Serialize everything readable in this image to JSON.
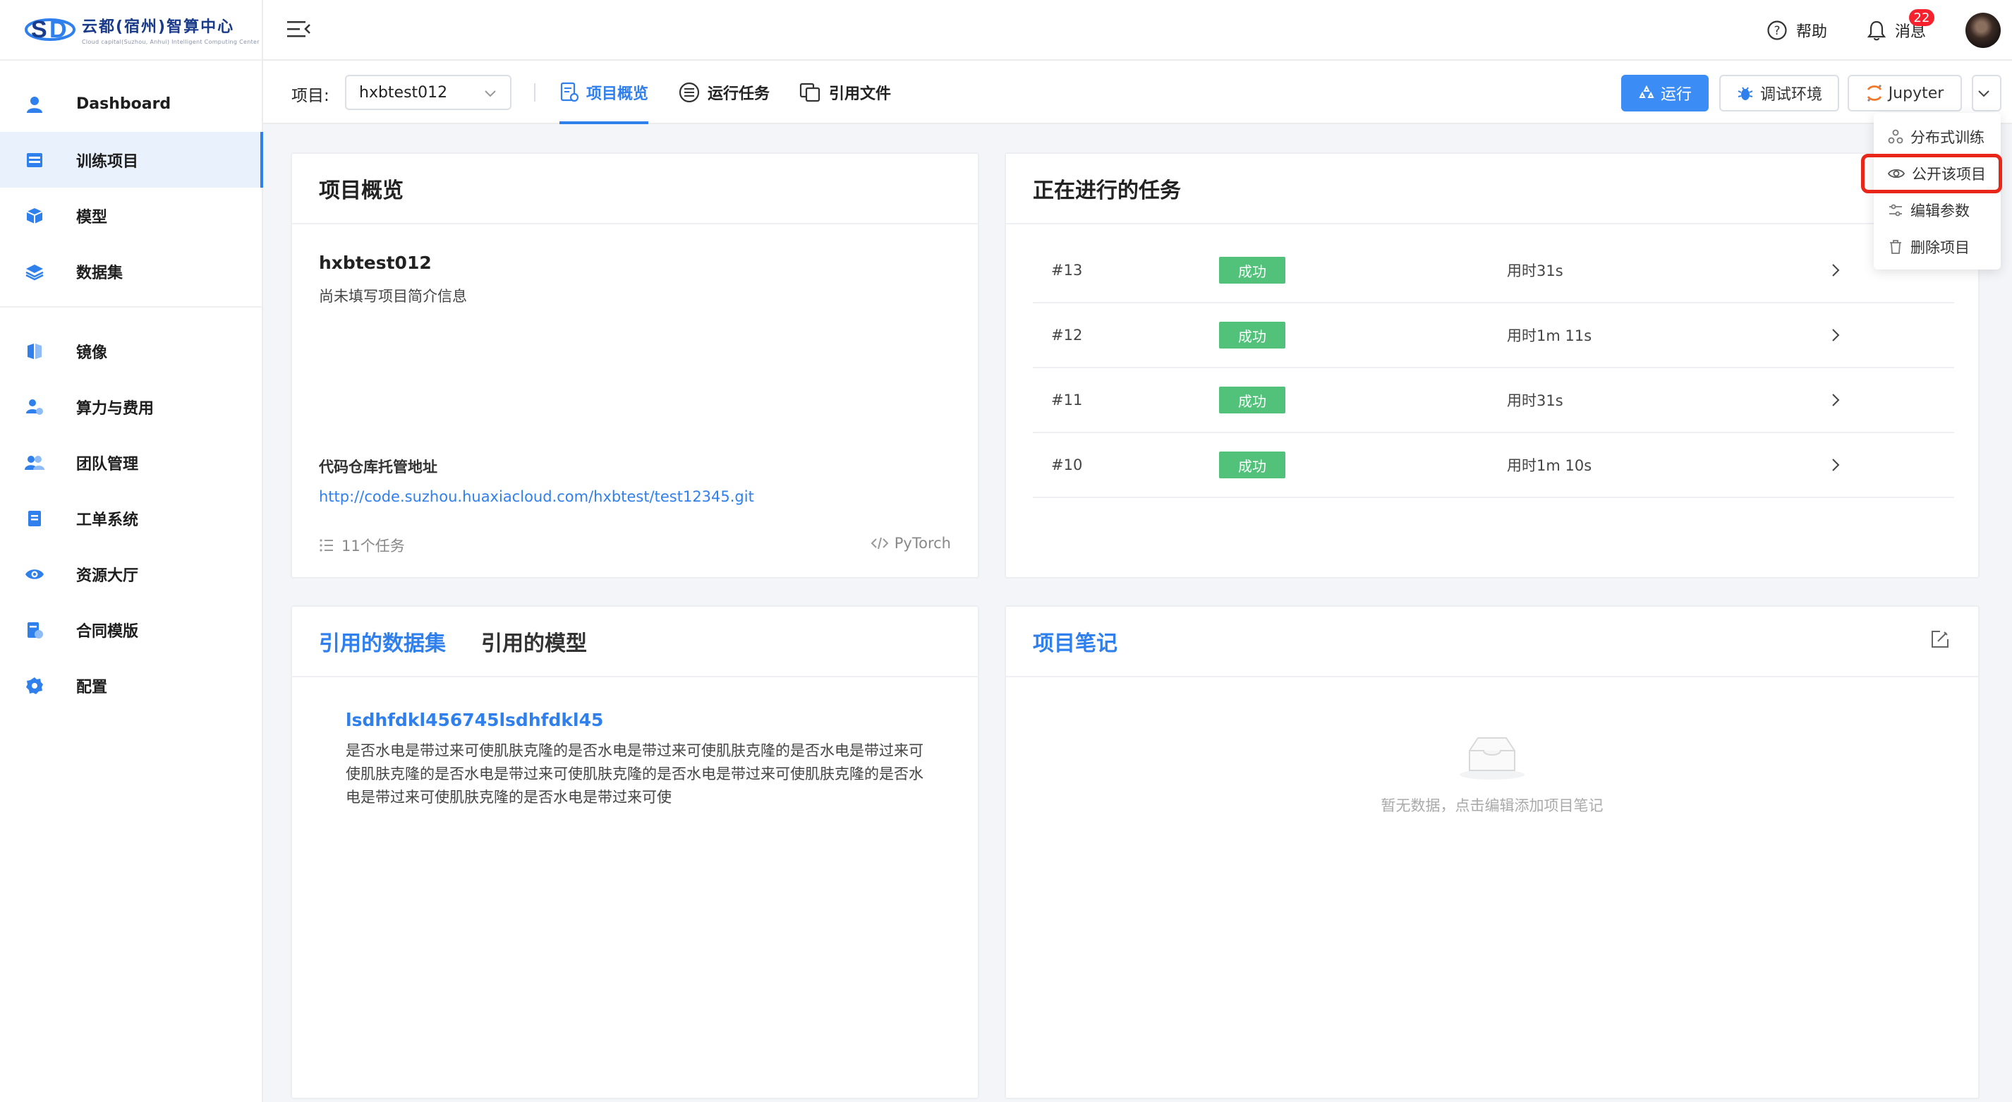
{
  "brand": {
    "name_cn": "云都(宿州)智算中心",
    "name_en": "Cloud capital(Suzhou, Anhui) Intelligent Computing Center"
  },
  "sidebar": {
    "items": [
      {
        "label": "Dashboard",
        "icon": "user-icon",
        "active": false
      },
      {
        "label": "训练项目",
        "icon": "project-icon",
        "active": true
      },
      {
        "label": "模型",
        "icon": "cube-icon",
        "active": false
      },
      {
        "label": "数据集",
        "icon": "layers-icon",
        "active": false
      },
      {
        "label": "镜像",
        "icon": "image-icon",
        "active": false
      },
      {
        "label": "算力与费用",
        "icon": "compute-cost-icon",
        "active": false
      },
      {
        "label": "团队管理",
        "icon": "team-icon",
        "active": false
      },
      {
        "label": "工单系统",
        "icon": "ticket-icon",
        "active": false
      },
      {
        "label": "资源大厅",
        "icon": "eye-icon",
        "active": false
      },
      {
        "label": "合同模版",
        "icon": "contract-icon",
        "active": false
      },
      {
        "label": "配置",
        "icon": "gear-icon",
        "active": false
      }
    ]
  },
  "topbar": {
    "help_label": "帮助",
    "messages_label": "消息",
    "messages_count": "22"
  },
  "subbar": {
    "project_label": "项目:",
    "project_value": "hxbtest012",
    "tabs": [
      {
        "label": "项目概览",
        "active": true
      },
      {
        "label": "运行任务",
        "active": false
      },
      {
        "label": "引用文件",
        "active": false
      }
    ],
    "run_label": "运行",
    "debug_label": "调试环境",
    "jupyter_label": "Jupyter"
  },
  "dropdown": {
    "items": [
      {
        "label": "分布式训练",
        "icon": "distributed-icon"
      },
      {
        "label": "公开该项目",
        "icon": "eye-icon"
      },
      {
        "label": "编辑参数",
        "icon": "sliders-icon"
      },
      {
        "label": "删除项目",
        "icon": "trash-icon"
      }
    ]
  },
  "overview": {
    "title": "项目概览",
    "project_name": "hxbtest012",
    "description": "尚未填写项目简介信息",
    "repo_label": "代码仓库托管地址",
    "repo_url": "http://code.suzhou.huaxiacloud.com/hxbtest/test12345.git",
    "task_count": "11个任务",
    "framework": "PyTorch"
  },
  "running_tasks": {
    "title": "正在进行的任务",
    "rows": [
      {
        "id": "#13",
        "status": "成功",
        "duration": "用时31s"
      },
      {
        "id": "#12",
        "status": "成功",
        "duration": "用时1m 11s"
      },
      {
        "id": "#11",
        "status": "成功",
        "duration": "用时31s"
      },
      {
        "id": "#10",
        "status": "成功",
        "duration": "用时1m 10s"
      }
    ]
  },
  "references": {
    "tab_datasets": "引用的数据集",
    "tab_models": "引用的模型",
    "dataset_name": "lsdhfdkl456745lsdhfdkl45",
    "dataset_desc": "是否水电是带过来可使肌肤克隆的是否水电是带过来可使肌肤克隆的是否水电是带过来可使肌肤克隆的是否水电是带过来可使肌肤克隆的是否水电是带过来可使肌肤克隆的是否水电是带过来可使肌肤克隆的是否水电是带过来可使"
  },
  "notes": {
    "title": "项目笔记",
    "empty_text": "暂无数据，点击编辑添加项目笔记"
  },
  "colors": {
    "accent": "#2f80ed",
    "success": "#52c27a",
    "badge": "#f5222d",
    "highlight": "#e8261a"
  }
}
